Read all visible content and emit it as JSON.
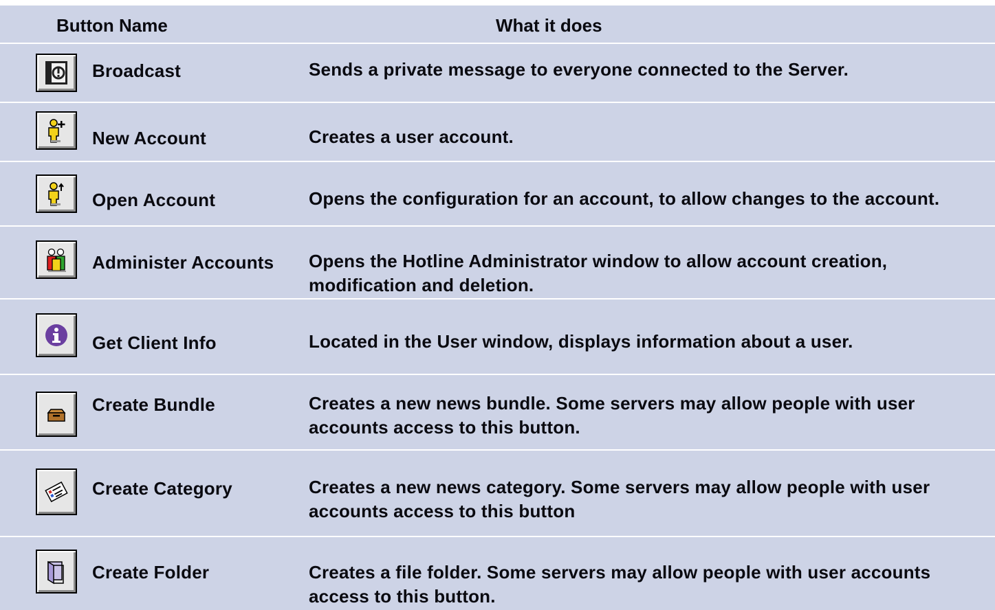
{
  "header": {
    "col1": "Button Name",
    "col2": "What it does"
  },
  "rows": [
    {
      "name": "Broadcast",
      "desc": "Sends a private message to everyone connected to the Server.",
      "icon": "broadcast-icon"
    },
    {
      "name": "New Account",
      "desc": "Creates a user account.",
      "icon": "new-account-icon"
    },
    {
      "name": "Open Account",
      "desc": "Opens the configuration for an account, to allow changes to the account.",
      "icon": "open-account-icon"
    },
    {
      "name": "Administer Accounts",
      "desc": "Opens the Hotline Administrator window to allow account creation, modification and deletion.",
      "icon": "administer-accounts-icon"
    },
    {
      "name": "Get Client Info",
      "desc": "Located in the User window, displays information about a user.",
      "icon": "info-icon"
    },
    {
      "name": "Create Bundle",
      "desc": "Creates a new news bundle. Some servers may allow people with user accounts access to this button.",
      "icon": "bundle-icon"
    },
    {
      "name": "Create Category",
      "desc": "Creates a new news category. Some servers may allow people with user accounts access to this button",
      "icon": "category-icon"
    },
    {
      "name": "Create Folder",
      "desc": "Creates a file folder. Some servers may allow people with user accounts access to this button.",
      "icon": "folder-icon"
    }
  ],
  "colors": {
    "background": "#cdd3e6",
    "separator": "#ffffff",
    "text": "#0a0a10",
    "info_purple": "#6b3fa0",
    "person_yellow": "#f2d21a"
  }
}
